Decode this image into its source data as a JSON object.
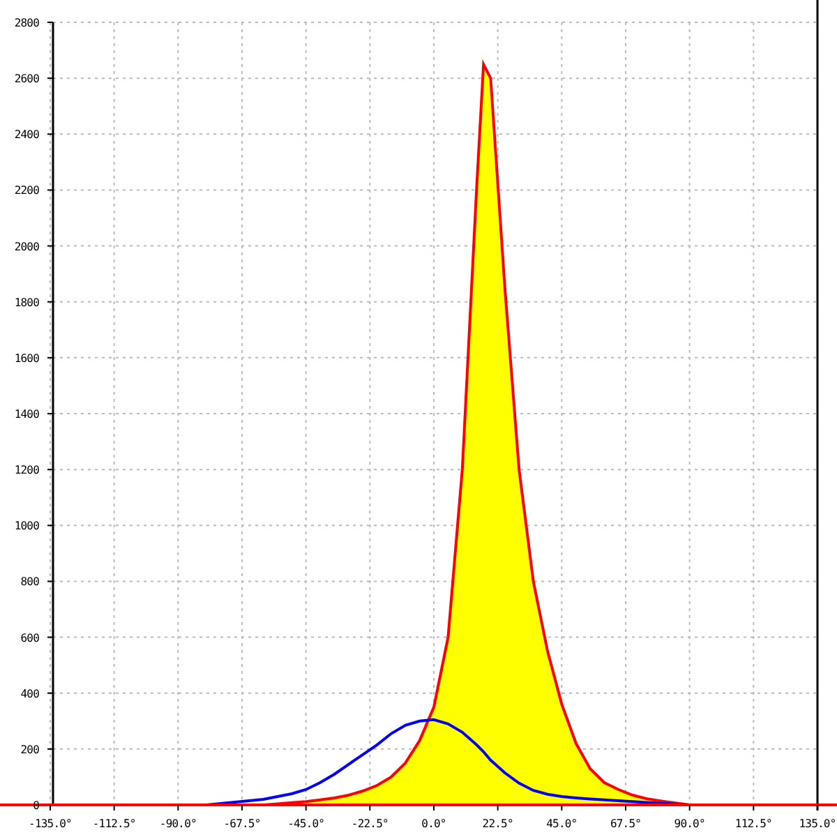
{
  "chart_data": {
    "type": "line",
    "x": [
      -80,
      -75,
      -70,
      -65,
      -60,
      -55,
      -50,
      -45,
      -40,
      -35,
      -30,
      -25,
      -20,
      -15,
      -10,
      -5,
      0,
      5,
      10,
      15,
      17.5,
      20,
      25,
      30,
      35,
      40,
      45,
      50,
      55,
      60,
      65,
      70,
      75,
      80,
      85,
      90
    ],
    "series": [
      {
        "type": "area",
        "color": "#ff0000",
        "values": [
          null,
          null,
          null,
          null,
          0,
          4,
          8,
          12,
          18,
          25,
          35,
          50,
          70,
          100,
          150,
          230,
          350,
          600,
          1200,
          2200,
          2650,
          2600,
          1850,
          1200,
          800,
          550,
          360,
          220,
          130,
          80,
          55,
          35,
          22,
          14,
          7,
          0
        ]
      },
      {
        "type": "line",
        "color": "#0000ff",
        "values": [
          0,
          5,
          10,
          15,
          20,
          30,
          40,
          55,
          80,
          110,
          145,
          180,
          215,
          255,
          285,
          300,
          305,
          290,
          260,
          215,
          190,
          160,
          115,
          78,
          52,
          38,
          30,
          25,
          21,
          18,
          15,
          12,
          9,
          6,
          3,
          0
        ]
      }
    ],
    "grid": true,
    "xlim": [
      -135,
      135
    ],
    "ylim": [
      0,
      2800
    ],
    "xticks": [
      {
        "value": -135,
        "label": "-135.0°"
      },
      {
        "value": -112.5,
        "label": "-112.5°"
      },
      {
        "value": -90,
        "label": "-90.0°"
      },
      {
        "value": -67.5,
        "label": "-67.5°"
      },
      {
        "value": -45,
        "label": "-45.0°"
      },
      {
        "value": -22.5,
        "label": "-22.5°"
      },
      {
        "value": 0,
        "label": "0.0°"
      },
      {
        "value": 22.5,
        "label": "22.5°"
      },
      {
        "value": 45,
        "label": "45.0°"
      },
      {
        "value": 67.5,
        "label": "67.5°"
      },
      {
        "value": 90,
        "label": "90.0°"
      },
      {
        "value": 112.5,
        "label": "112.5°"
      },
      {
        "value": 135,
        "label": "135.0°"
      }
    ],
    "yticks": [
      0,
      200,
      400,
      600,
      800,
      1000,
      1200,
      1400,
      1600,
      1800,
      2000,
      2200,
      2400,
      2600,
      2800
    ]
  }
}
